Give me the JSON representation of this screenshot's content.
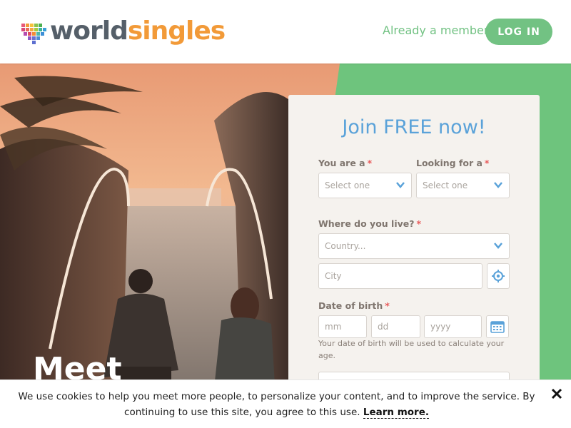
{
  "header": {
    "logo_world": "world",
    "logo_singles": "singles",
    "already_member": "Already a member?",
    "login_label": "LOG IN"
  },
  "hero": {
    "title": "Meet"
  },
  "form": {
    "title": "Join FREE now!",
    "you_are_label": "You are a",
    "you_are_placeholder": "Select one",
    "looking_for_label": "Looking for a",
    "looking_for_placeholder": "Select one",
    "where_live_label": "Where do you live?",
    "country_placeholder": "Country...",
    "city_placeholder": "City",
    "dob_label": "Date of birth",
    "dob_mm": "mm",
    "dob_dd": "dd",
    "dob_yyyy": "yyyy",
    "dob_hint": "Your date of birth will be used to calculate your age.",
    "required_mark": "*"
  },
  "cookie": {
    "text": "We use cookies to help you meet more people, to personalize your content, and to improve the service. By continuing to use this site, you agree to this use.",
    "learn_more": "Learn more."
  },
  "colors": {
    "brand_green": "#72c283",
    "brand_orange": "#f29a38",
    "form_title_blue": "#5aa2d9",
    "required_red": "#e85a5a"
  },
  "icons": {
    "close": "close-icon",
    "location": "crosshair-icon",
    "calendar": "calendar-icon",
    "chevron": "chevron-down-icon"
  }
}
